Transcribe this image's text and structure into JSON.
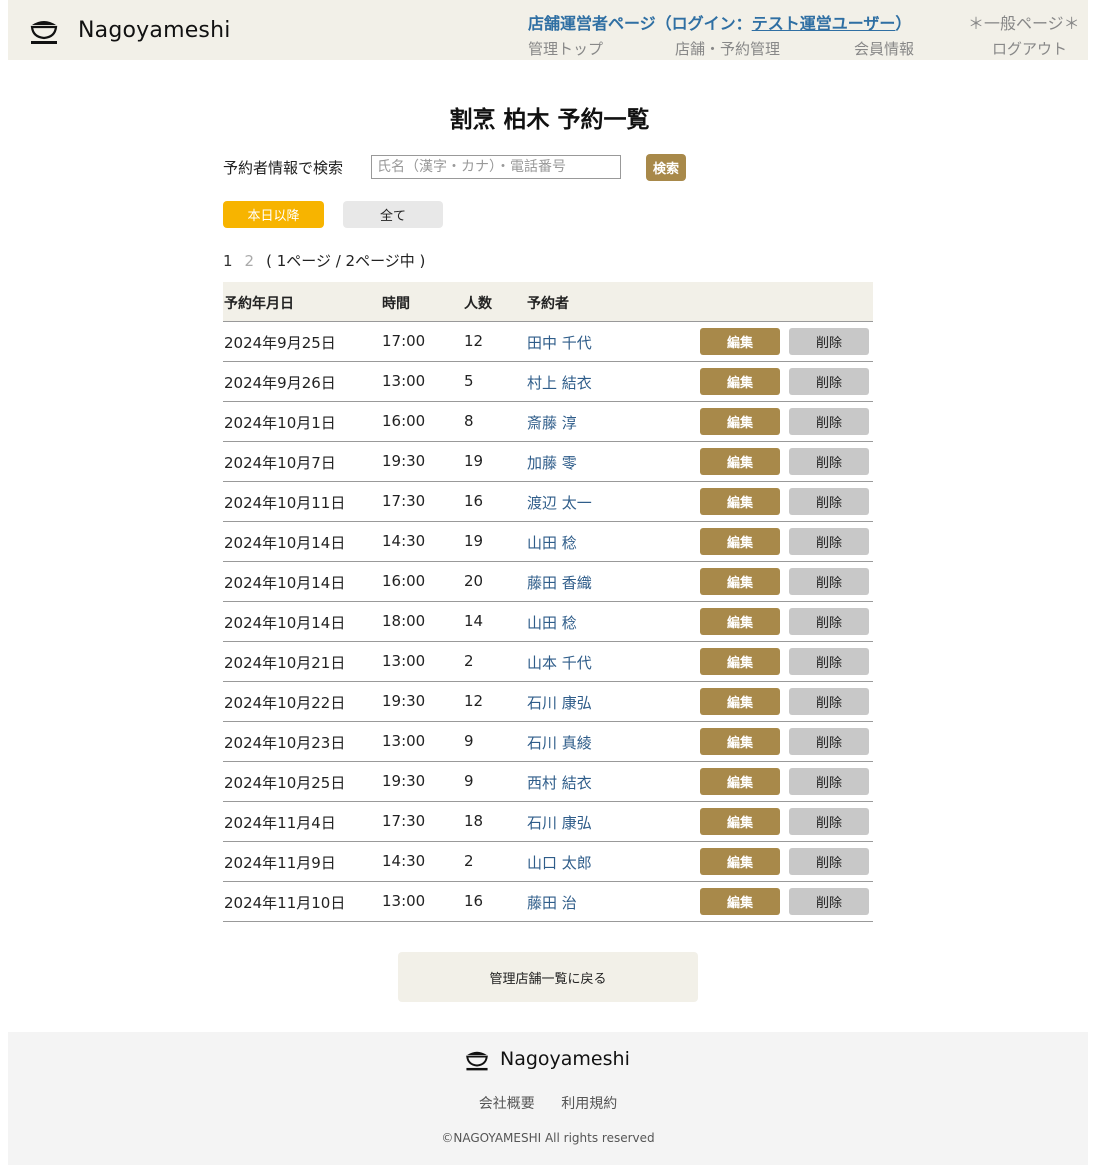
{
  "header": {
    "logo_text": "Nagoyameshi",
    "operator_prefix": "店舗運営者ページ（ログイン：",
    "operator_user": "テスト運営ユーザー",
    "operator_suffix": "）",
    "general_link": "＊一般ページ＊",
    "nav": [
      "管理トップ",
      "店舗・予約管理",
      "会員情報",
      "ログアウト"
    ]
  },
  "page_title": "割烹 柏木 予約一覧",
  "search": {
    "label": "予約者情報で検索",
    "placeholder": "氏名（漢字・カナ）・電話番号",
    "button": "検索"
  },
  "filters": {
    "today": "本日以降",
    "all": "全て"
  },
  "pagination": {
    "page1": "1",
    "page2": "2",
    "info": "( 1ページ / 2ページ中 )"
  },
  "table": {
    "headers": [
      "予約年月日",
      "時間",
      "人数",
      "予約者"
    ],
    "edit_label": "編集",
    "delete_label": "削除",
    "rows": [
      {
        "date": "2024年9月25日",
        "time": "17:00",
        "people": "12",
        "name": "田中 千代"
      },
      {
        "date": "2024年9月26日",
        "time": "13:00",
        "people": "5",
        "name": "村上 結衣"
      },
      {
        "date": "2024年10月1日",
        "time": "16:00",
        "people": "8",
        "name": "斎藤 淳"
      },
      {
        "date": "2024年10月7日",
        "time": "19:30",
        "people": "19",
        "name": "加藤 零"
      },
      {
        "date": "2024年10月11日",
        "time": "17:30",
        "people": "16",
        "name": "渡辺 太一"
      },
      {
        "date": "2024年10月14日",
        "time": "14:30",
        "people": "19",
        "name": "山田 稔"
      },
      {
        "date": "2024年10月14日",
        "time": "16:00",
        "people": "20",
        "name": "藤田 香織"
      },
      {
        "date": "2024年10月14日",
        "time": "18:00",
        "people": "14",
        "name": "山田 稔"
      },
      {
        "date": "2024年10月21日",
        "time": "13:00",
        "people": "2",
        "name": "山本 千代"
      },
      {
        "date": "2024年10月22日",
        "time": "19:30",
        "people": "12",
        "name": "石川 康弘"
      },
      {
        "date": "2024年10月23日",
        "time": "13:00",
        "people": "9",
        "name": "石川 真綾"
      },
      {
        "date": "2024年10月25日",
        "time": "19:30",
        "people": "9",
        "name": "西村 結衣"
      },
      {
        "date": "2024年11月4日",
        "time": "17:30",
        "people": "18",
        "name": "石川 康弘"
      },
      {
        "date": "2024年11月9日",
        "time": "14:30",
        "people": "2",
        "name": "山口 太郎"
      },
      {
        "date": "2024年11月10日",
        "time": "13:00",
        "people": "16",
        "name": "藤田 治"
      }
    ]
  },
  "back_button": "管理店舗一覧に戻る",
  "footer": {
    "logo_text": "Nagoyameshi",
    "links": [
      "会社概要",
      "利用規約"
    ],
    "copyright": "©NAGOYAMESHI All rights reserved"
  },
  "colors": {
    "header_bg": "#f2f0e8",
    "accent_gold": "#a8894a",
    "today_yellow": "#f7b400",
    "link_blue": "#2f6fa3",
    "delete_gray": "#c8c8c8"
  },
  "icons": {
    "logo": "rice-bowl-icon"
  }
}
